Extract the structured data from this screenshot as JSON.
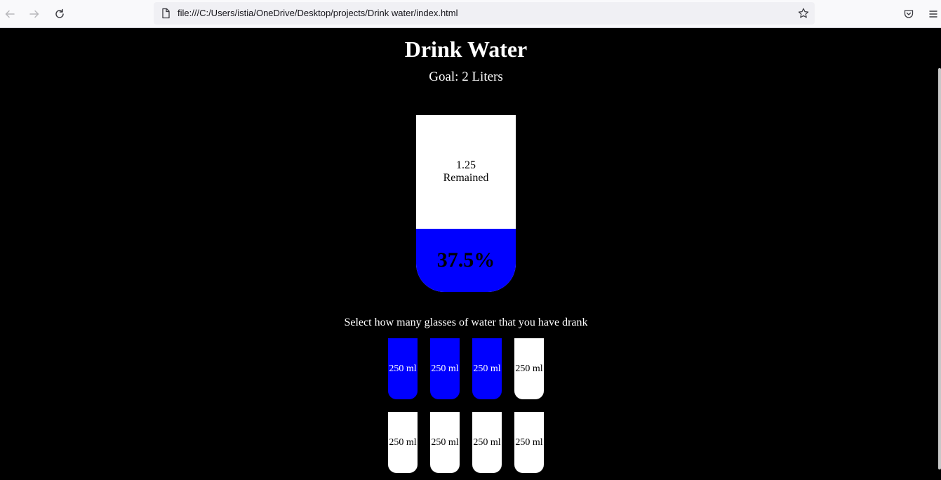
{
  "browser": {
    "url": "file:///C:/Users/istia/OneDrive/Desktop/projects/Drink water/index.html",
    "icons": [
      "back-icon",
      "forward-icon",
      "reload-icon",
      "page-icon",
      "bookmark-star-icon",
      "pocket-icon",
      "menu-icon"
    ]
  },
  "page": {
    "title": "Drink Water",
    "goal": "Goal: 2 Liters",
    "big_cup": {
      "remained_value": "1.25",
      "remained_label": "Remained",
      "percentage_text": "37.5%",
      "fill_fraction": 0.375
    },
    "instruction": "Select how many glasses of water that you have drank",
    "cups": [
      {
        "label": "250 ml",
        "full": true
      },
      {
        "label": "250 ml",
        "full": true
      },
      {
        "label": "250 ml",
        "full": true
      },
      {
        "label": "250 ml",
        "full": false
      },
      {
        "label": "250 ml",
        "full": false
      },
      {
        "label": "250 ml",
        "full": false
      },
      {
        "label": "250 ml",
        "full": false
      },
      {
        "label": "250 ml",
        "full": false
      }
    ],
    "colors": {
      "water": "#0000ff",
      "background": "#000000",
      "cup": "#ffffff"
    }
  }
}
